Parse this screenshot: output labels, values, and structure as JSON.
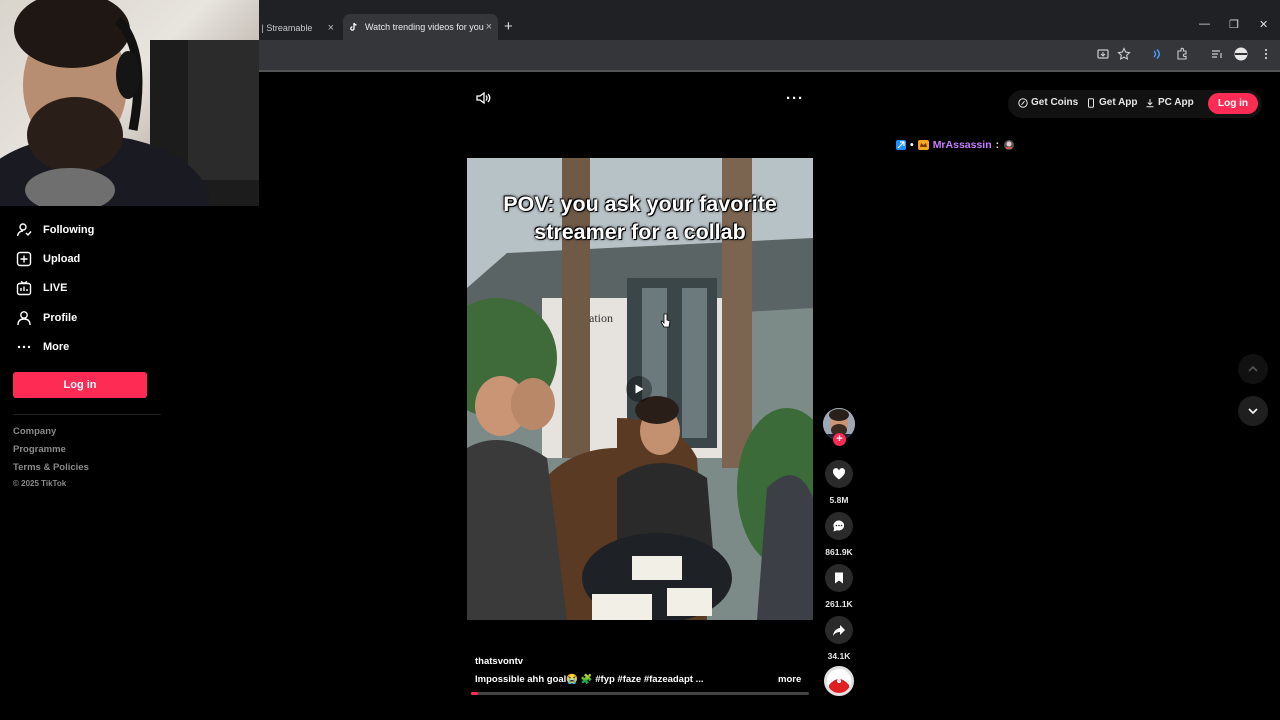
{
  "browser": {
    "tabs": [
      {
        "label": "h | Streamable",
        "close": "×"
      },
      {
        "label": "Watch trending videos for you",
        "close": "×"
      }
    ],
    "new_tab": "+",
    "window_controls": {
      "minimize": "—",
      "restore": "❐",
      "close": "✕"
    }
  },
  "sidebar": {
    "items": [
      {
        "label": "Following",
        "icon": "following-icon"
      },
      {
        "label": "Upload",
        "icon": "upload-icon"
      },
      {
        "label": "LIVE",
        "icon": "live-icon"
      },
      {
        "label": "Profile",
        "icon": "profile-icon"
      },
      {
        "label": "More",
        "icon": "more-icon"
      }
    ],
    "login_label": "Log in",
    "footer": {
      "links": [
        "Company",
        "Programme",
        "Terms & Policies"
      ],
      "copyright": "© 2025 TikTok"
    }
  },
  "header": {
    "get_coins": "Get Coins",
    "get_app": "Get App",
    "pc_app": "PC App",
    "login": "Log in"
  },
  "live_comment": {
    "separator": "•",
    "username": "MrAssassin",
    "colon": ":"
  },
  "player": {
    "more": "···",
    "caption": "POV: you ask your favorite streamer for a collab",
    "storefront_text": "ation",
    "progress": 0.02
  },
  "actions": {
    "follow_plus": "+",
    "likes": "5.8M",
    "comments": "861.9K",
    "saves": "261.1K",
    "shares": "34.1K"
  },
  "description": {
    "author": "thatsvontv",
    "text": "Impossible ahh goal😭 🧩 #fyp #faze #fazeadapt ...",
    "more": "more"
  },
  "colors": {
    "accent": "#fe2c55",
    "comment_username": "#c77dff",
    "background": "#000000"
  }
}
